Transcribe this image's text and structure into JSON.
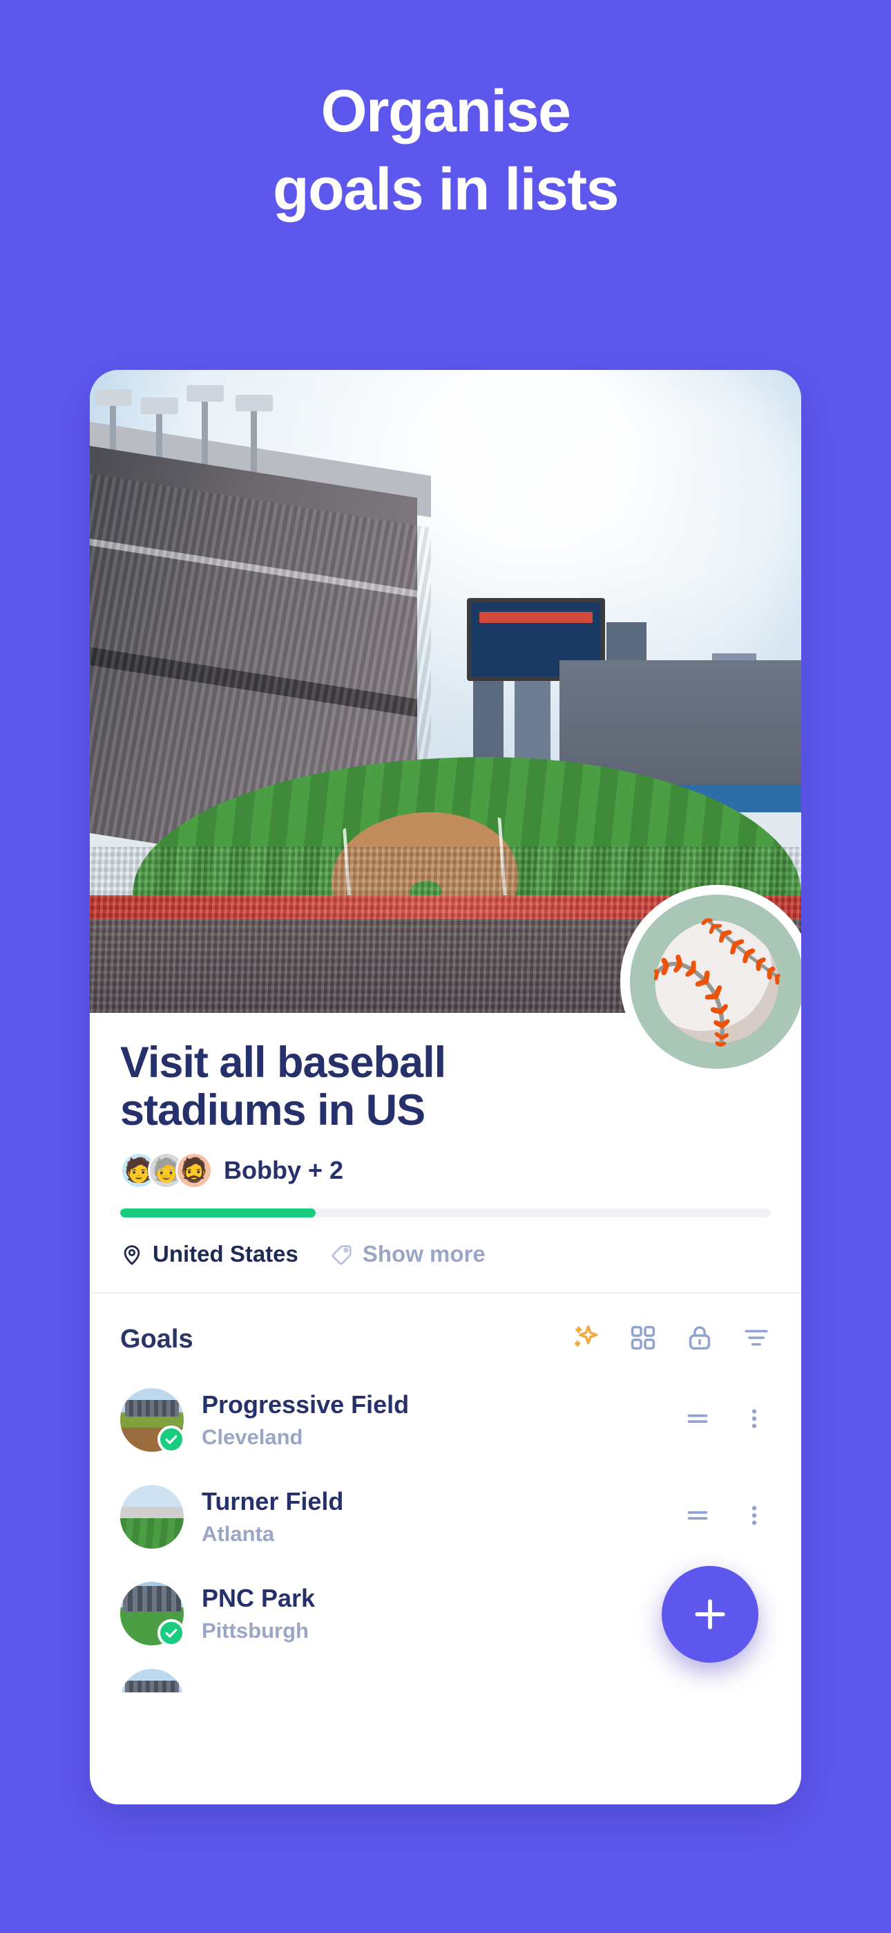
{
  "theme": {
    "background": "#5d57ee",
    "card_background": "#ffffff",
    "title_color": "#26306b",
    "muted_color": "#9aa6c4",
    "progress_color": "#19cc80",
    "accent_orange": "#f5a93c",
    "icon_blue_grey": "#8fa3cc",
    "badge_circle_color": "#a9c6b6"
  },
  "headline": {
    "line1": "Organise",
    "line2": "goals in lists"
  },
  "card": {
    "hero_image_alt": "progressive-field-stadium-photo",
    "badge_emoji": "⚾",
    "title": "Visit all baseball stadiums in US",
    "collaborators": {
      "avatars": [
        "memoji-brown-hair",
        "memoji-glasses-grey",
        "memoji-bearded"
      ],
      "label": "Bobby + 2"
    },
    "progress": {
      "percent": 30,
      "value_label": "30%"
    },
    "meta": [
      {
        "icon": "location-pin-icon",
        "label": "United States",
        "muted": false
      },
      {
        "icon": "tag-icon",
        "label": "Show more",
        "muted": true
      }
    ],
    "goals_section": {
      "heading": "Goals",
      "tools": [
        {
          "icon": "sparkles-icon",
          "name": "magic-suggest"
        },
        {
          "icon": "grid-view-icon",
          "name": "grid-view"
        },
        {
          "icon": "lock-icon",
          "name": "privacy-lock"
        },
        {
          "icon": "filter-icon",
          "name": "filter"
        }
      ],
      "items": [
        {
          "name": "Progressive Field",
          "location": "Cleveland",
          "completed": true,
          "thumb": "progressive-field-thumb",
          "controls": [
            "drag-handle-icon",
            "more-options-icon"
          ]
        },
        {
          "name": "Turner Field",
          "location": "Atlanta",
          "completed": false,
          "thumb": "turner-field-thumb",
          "controls": [
            "drag-handle-icon",
            "more-options-icon"
          ]
        },
        {
          "name": "PNC Park",
          "location": "Pittsburgh",
          "completed": true,
          "thumb": "pnc-park-thumb",
          "controls": []
        }
      ]
    },
    "fab": {
      "icon": "plus-icon",
      "label": "Add goal"
    }
  }
}
